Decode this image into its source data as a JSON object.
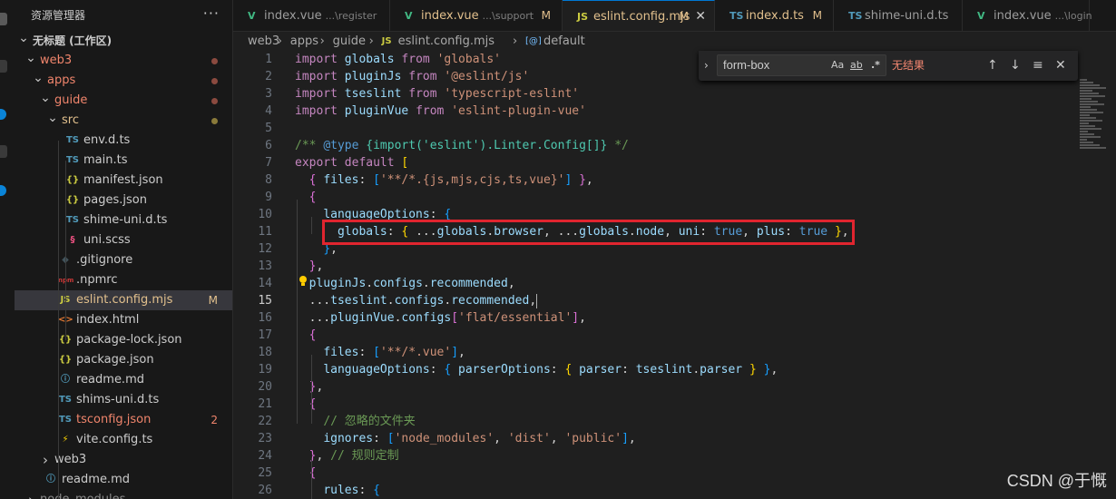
{
  "explorer": {
    "title": "资源管理器",
    "more": "···",
    "tree": [
      {
        "label": "无标题 (工作区)",
        "depth": 0,
        "chev": "down",
        "color": "#cccccc",
        "bold": true
      },
      {
        "label": "web3",
        "depth": 1,
        "chev": "down",
        "color": "#f0856c",
        "dot": "#8b4a3f"
      },
      {
        "label": "apps",
        "depth": 2,
        "chev": "down",
        "color": "#f0856c",
        "dot": "#8b4a3f"
      },
      {
        "label": "guide",
        "depth": 3,
        "chev": "down",
        "color": "#f0856c",
        "dot": "#8b4a3f"
      },
      {
        "label": "src",
        "depth": 4,
        "chev": "down",
        "color": "#e2c08d",
        "dot": "#8a7a3a"
      },
      {
        "label": "env.d.ts",
        "depth": 5,
        "icon": "TS",
        "iconColor": "#519aba",
        "color": "#cccccc"
      },
      {
        "label": "main.ts",
        "depth": 5,
        "icon": "TS",
        "iconColor": "#519aba",
        "color": "#cccccc"
      },
      {
        "label": "manifest.json",
        "depth": 5,
        "icon": "{}",
        "iconColor": "#cbcb41",
        "color": "#cccccc"
      },
      {
        "label": "pages.json",
        "depth": 5,
        "icon": "{}",
        "iconColor": "#cbcb41",
        "color": "#cccccc"
      },
      {
        "label": "shime-uni.d.ts",
        "depth": 5,
        "icon": "TS",
        "iconColor": "#519aba",
        "color": "#cccccc"
      },
      {
        "label": "uni.scss",
        "depth": 5,
        "icon": "§",
        "iconColor": "#f55385",
        "color": "#cccccc"
      },
      {
        "label": ".gitignore",
        "depth": 4,
        "icon": "◆",
        "iconColor": "#41535b",
        "color": "#cccccc"
      },
      {
        "label": ".npmrc",
        "depth": 4,
        "icon": "npm",
        "iconColor": "#cb3837",
        "color": "#cccccc"
      },
      {
        "label": "eslint.config.mjs",
        "depth": 4,
        "icon": "JS",
        "iconColor": "#cbcb41",
        "color": "#e2c08d",
        "badge": "M",
        "badgeColor": "#e2c08d",
        "selected": true
      },
      {
        "label": "index.html",
        "depth": 4,
        "icon": "<>",
        "iconColor": "#e37933",
        "color": "#cccccc"
      },
      {
        "label": "package-lock.json",
        "depth": 4,
        "icon": "{}",
        "iconColor": "#cbcb41",
        "color": "#cccccc"
      },
      {
        "label": "package.json",
        "depth": 4,
        "icon": "{}",
        "iconColor": "#cbcb41",
        "color": "#cccccc"
      },
      {
        "label": "readme.md",
        "depth": 4,
        "icon": "ⓘ",
        "iconColor": "#519aba",
        "color": "#cccccc"
      },
      {
        "label": "shims-uni.d.ts",
        "depth": 4,
        "icon": "TS",
        "iconColor": "#519aba",
        "color": "#cccccc"
      },
      {
        "label": "tsconfig.json",
        "depth": 4,
        "icon": "TS",
        "iconColor": "#519aba",
        "color": "#f0856c",
        "badge": "2",
        "badgeColor": "#f0856c"
      },
      {
        "label": "vite.config.ts",
        "depth": 4,
        "icon": "⚡",
        "iconColor": "#ffd700",
        "color": "#cccccc"
      },
      {
        "label": "web3",
        "depth": 3,
        "chev": "right",
        "color": "#cccccc"
      },
      {
        "label": "readme.md",
        "depth": 2,
        "icon": "ⓘ",
        "iconColor": "#519aba",
        "color": "#cccccc"
      },
      {
        "label": "node_modules",
        "depth": 1,
        "chev": "right",
        "color": "#8c8c8c"
      }
    ]
  },
  "tabs": [
    {
      "icon": "V",
      "iconColor": "#41b883",
      "name": "index.vue",
      "sub": "...\\register",
      "mod": "",
      "active": false
    },
    {
      "icon": "V",
      "iconColor": "#41b883",
      "name": "index.vue",
      "sub": "...\\support",
      "mod": "M",
      "active": false
    },
    {
      "icon": "JS",
      "iconColor": "#cbcb41",
      "name": "eslint.config.mjs",
      "sub": "",
      "mod": "M",
      "active": true,
      "close": "✕"
    },
    {
      "icon": "TS",
      "iconColor": "#519aba",
      "name": "index.d.ts",
      "sub": "",
      "mod": "M",
      "active": false
    },
    {
      "icon": "TS",
      "iconColor": "#519aba",
      "name": "shime-uni.d.ts",
      "sub": "",
      "mod": "",
      "active": false
    },
    {
      "icon": "V",
      "iconColor": "#41b883",
      "name": "index.vue",
      "sub": "...\\login",
      "mod": "",
      "active": false
    }
  ],
  "breadcrumb": {
    "parts": [
      "web3",
      "apps",
      "guide"
    ],
    "file": "eslint.config.mjs",
    "file_icon": "JS",
    "symbol": "default",
    "symbol_icon": "[@]",
    "separator": "›"
  },
  "find_widget": {
    "chevron": "›",
    "query": "form-box",
    "opt_case": "Aa",
    "opt_word": "ab",
    "opt_regex": ".*",
    "result": "无结果",
    "prev": "↑",
    "next": "↓",
    "selection": "≡",
    "close": "✕"
  },
  "editor": {
    "current_line": 15,
    "lines": [
      {
        "n": 1,
        "indent": 0,
        "tokens": [
          [
            "kc",
            "import"
          ],
          [
            "w",
            " "
          ],
          [
            "v",
            "globals"
          ],
          [
            "w",
            " "
          ],
          [
            "kc",
            "from"
          ],
          [
            "w",
            " "
          ],
          [
            "s",
            "'globals'"
          ]
        ]
      },
      {
        "n": 2,
        "indent": 0,
        "tokens": [
          [
            "kc",
            "import"
          ],
          [
            "w",
            " "
          ],
          [
            "v",
            "pluginJs"
          ],
          [
            "w",
            " "
          ],
          [
            "kc",
            "from"
          ],
          [
            "w",
            " "
          ],
          [
            "s",
            "'@eslint/js'"
          ]
        ]
      },
      {
        "n": 3,
        "indent": 0,
        "tokens": [
          [
            "kc",
            "import"
          ],
          [
            "w",
            " "
          ],
          [
            "v",
            "tseslint"
          ],
          [
            "w",
            " "
          ],
          [
            "kc",
            "from"
          ],
          [
            "w",
            " "
          ],
          [
            "s",
            "'typescript-eslint'"
          ]
        ]
      },
      {
        "n": 4,
        "indent": 0,
        "tokens": [
          [
            "kc",
            "import"
          ],
          [
            "w",
            " "
          ],
          [
            "v",
            "pluginVue"
          ],
          [
            "w",
            " "
          ],
          [
            "kc",
            "from"
          ],
          [
            "w",
            " "
          ],
          [
            "s",
            "'eslint-plugin-vue'"
          ]
        ]
      },
      {
        "n": 5,
        "indent": 0,
        "tokens": []
      },
      {
        "n": 6,
        "indent": 0,
        "tokens": [
          [
            "c",
            "/** "
          ],
          [
            "k",
            "@type"
          ],
          [
            "c",
            " "
          ],
          [
            "f",
            "{import('eslint').Linter.Config[]}"
          ],
          [
            "c",
            " */"
          ]
        ]
      },
      {
        "n": 7,
        "indent": 0,
        "tokens": [
          [
            "kc",
            "export"
          ],
          [
            "w",
            " "
          ],
          [
            "kc",
            "default"
          ],
          [
            "w",
            " "
          ],
          [
            "y",
            "["
          ]
        ]
      },
      {
        "n": 8,
        "indent": 1,
        "tokens": [
          [
            "pb",
            "{"
          ],
          [
            "w",
            " "
          ],
          [
            "v",
            "files"
          ],
          [
            "w",
            ": "
          ],
          [
            "bl",
            "["
          ],
          [
            "s",
            "'**/*.{js,mjs,cjs,ts,vue}'"
          ],
          [
            "bl",
            "]"
          ],
          [
            "w",
            " "
          ],
          [
            "pb",
            "}"
          ],
          [
            "w",
            ","
          ]
        ]
      },
      {
        "n": 9,
        "indent": 1,
        "tokens": [
          [
            "pb",
            "{"
          ]
        ]
      },
      {
        "n": 10,
        "indent": 2,
        "tokens": [
          [
            "v",
            "languageOptions"
          ],
          [
            "w",
            ": "
          ],
          [
            "bl",
            "{"
          ]
        ]
      },
      {
        "n": 11,
        "indent": 3,
        "tokens": [
          [
            "v",
            "globals"
          ],
          [
            "w",
            ": "
          ],
          [
            "y",
            "{"
          ],
          [
            "w",
            " ..."
          ],
          [
            "v",
            "globals"
          ],
          [
            "w",
            "."
          ],
          [
            "v",
            "browser"
          ],
          [
            "w",
            ", ..."
          ],
          [
            "v",
            "globals"
          ],
          [
            "w",
            "."
          ],
          [
            "v",
            "node"
          ],
          [
            "w",
            ", "
          ],
          [
            "v",
            "uni"
          ],
          [
            "w",
            ": "
          ],
          [
            "k",
            "true"
          ],
          [
            "w",
            ", "
          ],
          [
            "v",
            "plus"
          ],
          [
            "w",
            ": "
          ],
          [
            "k",
            "true"
          ],
          [
            "w",
            " "
          ],
          [
            "y",
            "}"
          ],
          [
            "w",
            ","
          ]
        ]
      },
      {
        "n": 12,
        "indent": 2,
        "tokens": [
          [
            "bl",
            "}"
          ],
          [
            "w",
            ","
          ]
        ]
      },
      {
        "n": 13,
        "indent": 1,
        "tokens": [
          [
            "pb",
            "}"
          ],
          [
            "w",
            ","
          ]
        ]
      },
      {
        "n": 14,
        "indent": 1,
        "tokens": [
          [
            "v",
            "pluginJs"
          ],
          [
            "w",
            "."
          ],
          [
            "v",
            "configs"
          ],
          [
            "w",
            "."
          ],
          [
            "v",
            "recommended"
          ],
          [
            "w",
            ","
          ]
        ]
      },
      {
        "n": 15,
        "indent": 1,
        "tokens": [
          [
            "w",
            "..."
          ],
          [
            "v",
            "tseslint"
          ],
          [
            "w",
            "."
          ],
          [
            "v",
            "configs"
          ],
          [
            "w",
            "."
          ],
          [
            "v",
            "recommended"
          ],
          [
            "w",
            ","
          ]
        ]
      },
      {
        "n": 16,
        "indent": 1,
        "tokens": [
          [
            "w",
            "..."
          ],
          [
            "v",
            "pluginVue"
          ],
          [
            "w",
            "."
          ],
          [
            "v",
            "configs"
          ],
          [
            "pb",
            "["
          ],
          [
            "s",
            "'flat/essential'"
          ],
          [
            "pb",
            "]"
          ],
          [
            "w",
            ","
          ]
        ]
      },
      {
        "n": 17,
        "indent": 1,
        "tokens": [
          [
            "pb",
            "{"
          ]
        ]
      },
      {
        "n": 18,
        "indent": 2,
        "tokens": [
          [
            "v",
            "files"
          ],
          [
            "w",
            ": "
          ],
          [
            "bl",
            "["
          ],
          [
            "s",
            "'**/*.vue'"
          ],
          [
            "bl",
            "]"
          ],
          [
            "w",
            ","
          ]
        ]
      },
      {
        "n": 19,
        "indent": 2,
        "tokens": [
          [
            "v",
            "languageOptions"
          ],
          [
            "w",
            ": "
          ],
          [
            "bl",
            "{"
          ],
          [
            "w",
            " "
          ],
          [
            "v",
            "parserOptions"
          ],
          [
            "w",
            ": "
          ],
          [
            "y",
            "{"
          ],
          [
            "w",
            " "
          ],
          [
            "v",
            "parser"
          ],
          [
            "w",
            ": "
          ],
          [
            "v",
            "tseslint"
          ],
          [
            "w",
            "."
          ],
          [
            "v",
            "parser"
          ],
          [
            "w",
            " "
          ],
          [
            "y",
            "}"
          ],
          [
            "w",
            " "
          ],
          [
            "bl",
            "}"
          ],
          [
            "w",
            ","
          ]
        ]
      },
      {
        "n": 20,
        "indent": 1,
        "tokens": [
          [
            "pb",
            "}"
          ],
          [
            "w",
            ","
          ]
        ]
      },
      {
        "n": 21,
        "indent": 1,
        "tokens": [
          [
            "pb",
            "{"
          ]
        ]
      },
      {
        "n": 22,
        "indent": 2,
        "tokens": [
          [
            "c",
            "// 忽略的文件夹"
          ]
        ]
      },
      {
        "n": 23,
        "indent": 2,
        "tokens": [
          [
            "v",
            "ignores"
          ],
          [
            "w",
            ": "
          ],
          [
            "bl",
            "["
          ],
          [
            "s",
            "'node_modules'"
          ],
          [
            "w",
            ", "
          ],
          [
            "s",
            "'dist'"
          ],
          [
            "w",
            ", "
          ],
          [
            "s",
            "'public'"
          ],
          [
            "bl",
            "]"
          ],
          [
            "w",
            ","
          ]
        ]
      },
      {
        "n": 24,
        "indent": 1,
        "tokens": [
          [
            "pb",
            "}"
          ],
          [
            "w",
            ", "
          ],
          [
            "c",
            "// 规则定制"
          ]
        ]
      },
      {
        "n": 25,
        "indent": 1,
        "tokens": [
          [
            "pb",
            "{"
          ]
        ]
      },
      {
        "n": 26,
        "indent": 2,
        "tokens": [
          [
            "v",
            "rules"
          ],
          [
            "w",
            ": "
          ],
          [
            "bl",
            "{"
          ]
        ]
      }
    ]
  },
  "watermark": "CSDN @于慨",
  "colors": {
    "highlight_box": "#e0252f",
    "accent": "#0078d4"
  }
}
